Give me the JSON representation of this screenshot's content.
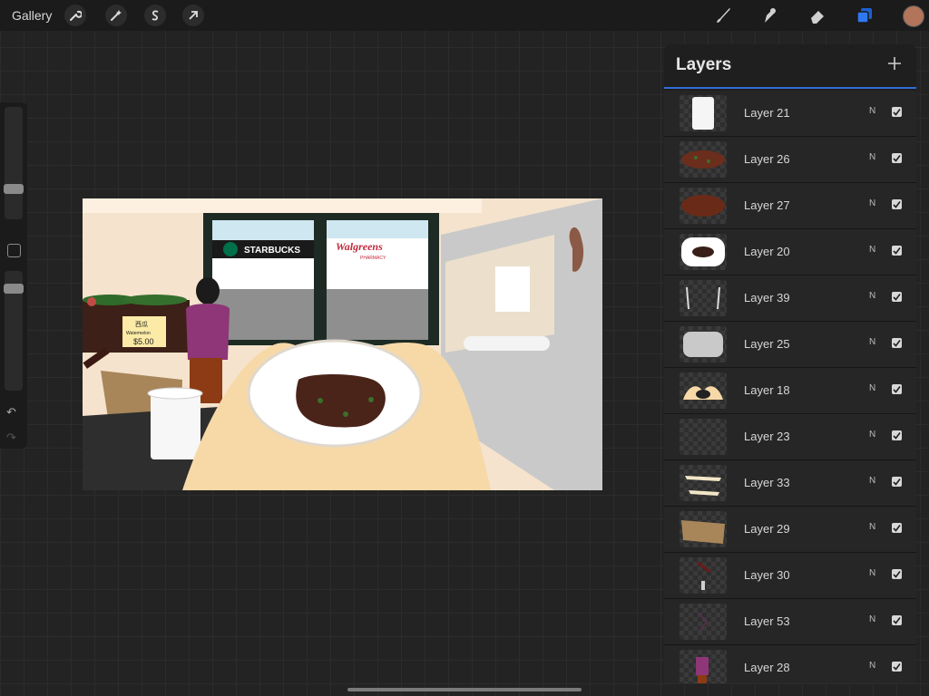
{
  "topbar": {
    "gallery_label": "Gallery",
    "actions_icon": "wrench-icon",
    "adjustments_icon": "magic-wand-icon",
    "selection_icon": "selection-s-icon",
    "transform_icon": "arrow-cursor-icon",
    "brush_icon": "brush-icon",
    "smudge_icon": "smudge-icon",
    "eraser_icon": "eraser-icon",
    "layers_icon": "layers-icon",
    "current_color": "#b2745a"
  },
  "sidebar": {
    "brush_size_level": 0.23,
    "opacity_level": 0.12
  },
  "canvas": {
    "signs": {
      "starbucks": "STARBUCKS",
      "walgreens": "Walgreens",
      "pharmacy": "PHARMACY",
      "price_tag_cn": "西瓜",
      "price_tag_en": "Watermelon",
      "price_tag_price": "$5.00"
    }
  },
  "layers_panel": {
    "title": "Layers",
    "add_icon": "plus-icon",
    "layers": [
      {
        "name": "Layer 21",
        "blend": "N",
        "visible": true
      },
      {
        "name": "Layer 26",
        "blend": "N",
        "visible": true
      },
      {
        "name": "Layer 27",
        "blend": "N",
        "visible": true
      },
      {
        "name": "Layer 20",
        "blend": "N",
        "visible": true
      },
      {
        "name": "Layer 39",
        "blend": "N",
        "visible": true
      },
      {
        "name": "Layer 25",
        "blend": "N",
        "visible": true
      },
      {
        "name": "Layer 18",
        "blend": "N",
        "visible": true
      },
      {
        "name": "Layer 23",
        "blend": "N",
        "visible": true
      },
      {
        "name": "Layer 33",
        "blend": "N",
        "visible": true
      },
      {
        "name": "Layer 29",
        "blend": "N",
        "visible": true
      },
      {
        "name": "Layer 30",
        "blend": "N",
        "visible": true
      },
      {
        "name": "Layer 53",
        "blend": "N",
        "visible": true
      },
      {
        "name": "Layer 28",
        "blend": "N",
        "visible": true
      }
    ]
  }
}
